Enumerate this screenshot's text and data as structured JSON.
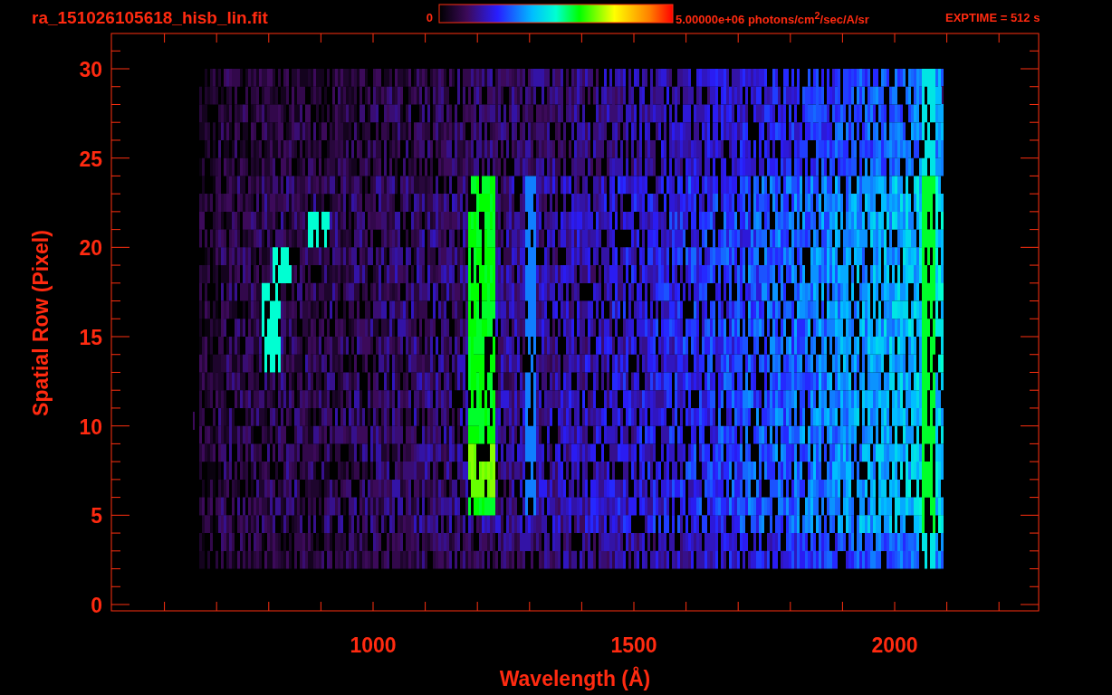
{
  "title": "ra_151026105618_hisb_lin.fit",
  "colorbar": {
    "min_label": "0",
    "max_label": "5.00000e+06 photons/cm$^{2}$/sec/A/sr"
  },
  "exposure": "EXPTIME = 512 s",
  "x_axis": {
    "label": "Wavelength (Å)",
    "ticks": [
      "1000",
      "1500",
      "2000"
    ]
  },
  "y_axis": {
    "label": "Spatial Row (Pixel)",
    "ticks": [
      "30",
      "25",
      "20",
      "15",
      "10",
      "5",
      "0"
    ]
  }
}
